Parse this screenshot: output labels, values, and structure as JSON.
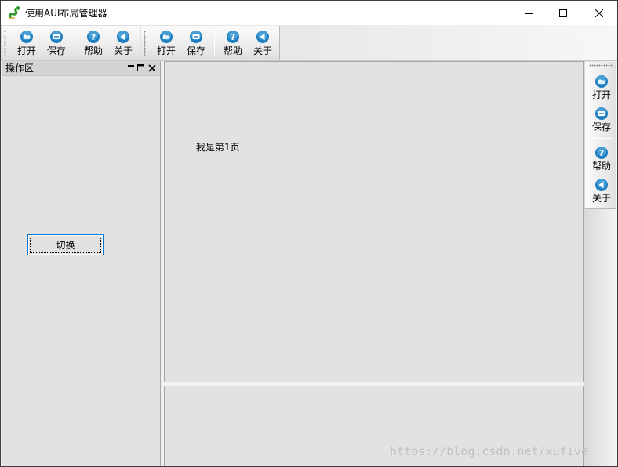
{
  "window": {
    "title": "使用AUI布局管理器"
  },
  "toolbar1": {
    "items": [
      {
        "label": "打开",
        "icon": "open-folder-icon"
      },
      {
        "label": "保存",
        "icon": "save-icon"
      },
      {
        "label": "帮助",
        "icon": "help-icon"
      },
      {
        "label": "关于",
        "icon": "about-icon"
      }
    ]
  },
  "toolbar2": {
    "items": [
      {
        "label": "打开",
        "icon": "open-folder-icon"
      },
      {
        "label": "保存",
        "icon": "save-icon"
      },
      {
        "label": "帮助",
        "icon": "help-icon"
      },
      {
        "label": "关于",
        "icon": "about-icon"
      }
    ]
  },
  "right_toolbar": {
    "items": [
      {
        "label": "打开",
        "icon": "open-folder-icon"
      },
      {
        "label": "保存",
        "icon": "save-icon"
      },
      {
        "label": "帮助",
        "icon": "help-icon"
      },
      {
        "label": "关于",
        "icon": "about-icon"
      }
    ]
  },
  "left_pane": {
    "title": "操作区",
    "switch_button": "切换"
  },
  "center_pane": {
    "page_text": "我是第1页"
  },
  "watermark": "https://blog.csdn.net/xufive",
  "colors": {
    "icon_blue": "#1f7fbf",
    "focus_border": "#0078d7",
    "pane_bg": "#e2e2e2"
  }
}
